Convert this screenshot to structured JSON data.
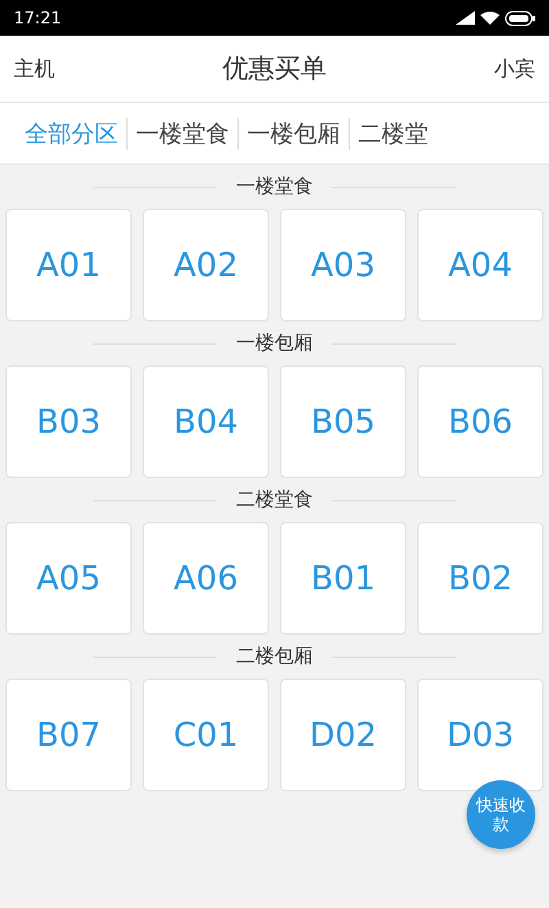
{
  "status_bar": {
    "time": "17:21"
  },
  "header": {
    "left": "主机",
    "title": "优惠买单",
    "right": "小宾"
  },
  "tabs": [
    {
      "label": "全部分区",
      "selected": true
    },
    {
      "label": "一楼堂食",
      "selected": false
    },
    {
      "label": "一楼包厢",
      "selected": false
    },
    {
      "label": "二楼堂",
      "selected": false
    }
  ],
  "sections": [
    {
      "title": "一楼堂食",
      "tables": [
        "A01",
        "A02",
        "A03",
        "A04"
      ]
    },
    {
      "title": "一楼包厢",
      "tables": [
        "B03",
        "B04",
        "B05",
        "B06"
      ]
    },
    {
      "title": "二楼堂食",
      "tables": [
        "A05",
        "A06",
        "B01",
        "B02"
      ]
    },
    {
      "title": "二楼包厢",
      "tables": [
        "B07",
        "C01",
        "D02",
        "D03"
      ]
    }
  ],
  "fab": {
    "label": "快速收款"
  }
}
